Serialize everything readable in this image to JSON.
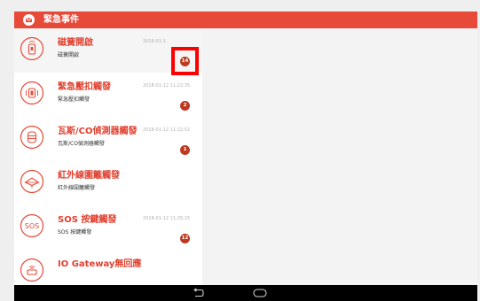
{
  "header": {
    "title": "緊急事件",
    "color": "#e84a39",
    "icon": "envelope-icon"
  },
  "events": [
    {
      "icon": "door-sensor-icon",
      "title": "磁簧開啟",
      "subtitle": "磁簧開啟",
      "timestamp": "2018-01-1",
      "count": "14",
      "selected": true
    },
    {
      "icon": "emergency-button-icon",
      "title": "緊急壓扣觸發",
      "subtitle": "緊急壓扣觸發",
      "timestamp": "2018-01-12 11:22:35",
      "count": "2"
    },
    {
      "icon": "gas-co-detector-icon",
      "title": "瓦斯/CO偵測器觸發",
      "subtitle": "瓦斯/CO偵測器觸發",
      "timestamp": "2018-01-12 11:22:52",
      "count": "1"
    },
    {
      "icon": "infrared-fence-icon",
      "title": "紅外線圍籬觸發",
      "subtitle": "紅外線圍籬觸發",
      "timestamp": "",
      "count": ""
    },
    {
      "icon": "sos-icon",
      "title": "SOS 按鍵觸發",
      "subtitle": "SOS 按鍵觸發",
      "timestamp": "2018-01-12 11:25:15",
      "count": "12"
    },
    {
      "icon": "io-gateway-icon",
      "title": "IO Gateway無回應",
      "subtitle": "",
      "timestamp": "",
      "count": ""
    }
  ],
  "navbar": {
    "back_icon": "back-arrow-icon",
    "home_icon": "home-icon"
  },
  "colors": {
    "accent": "#e84a39",
    "badge": "#bd3920",
    "highlight": "#ff0000"
  }
}
